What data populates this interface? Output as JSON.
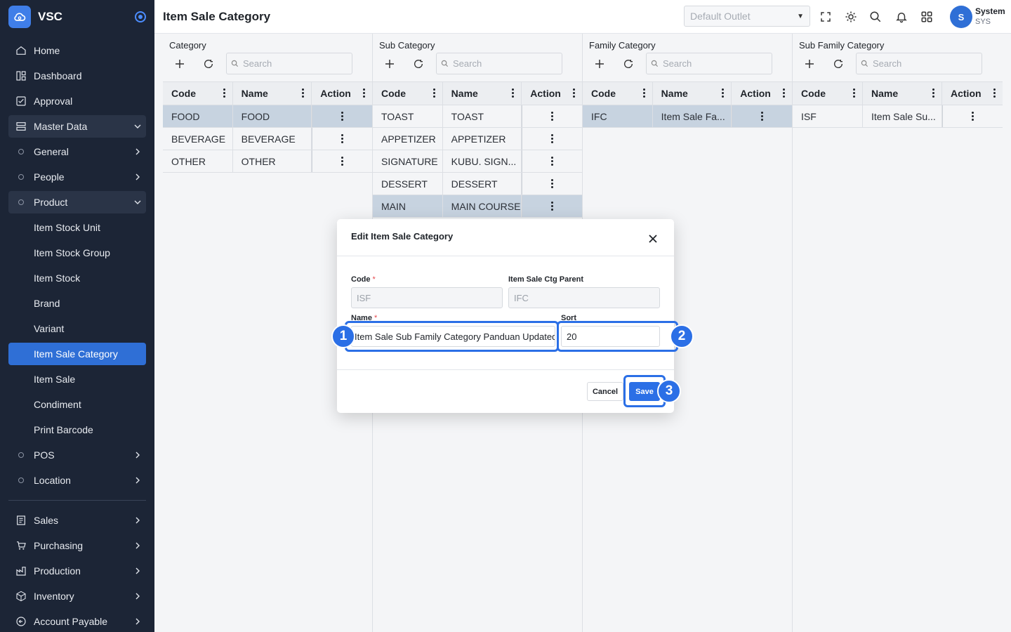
{
  "app": {
    "name": "VSC"
  },
  "sidebar": {
    "items": [
      {
        "label": "Home",
        "icon": "home-icon"
      },
      {
        "label": "Dashboard",
        "icon": "dashboard-icon"
      },
      {
        "label": "Approval",
        "icon": "approval-icon"
      },
      {
        "label": "Master Data",
        "icon": "master-data-icon"
      },
      {
        "label": "General"
      },
      {
        "label": "People"
      },
      {
        "label": "Product"
      },
      {
        "label": "Item Stock Unit"
      },
      {
        "label": "Item Stock Group"
      },
      {
        "label": "Item Stock"
      },
      {
        "label": "Brand"
      },
      {
        "label": "Variant"
      },
      {
        "label": "Item Sale Category"
      },
      {
        "label": "Item Sale"
      },
      {
        "label": "Condiment"
      },
      {
        "label": "Print Barcode"
      },
      {
        "label": "POS"
      },
      {
        "label": "Location"
      },
      {
        "label": "Sales",
        "icon": "sales-icon"
      },
      {
        "label": "Purchasing",
        "icon": "cart-icon"
      },
      {
        "label": "Production",
        "icon": "factory-icon"
      },
      {
        "label": "Inventory",
        "icon": "box-icon"
      },
      {
        "label": "Account Payable",
        "icon": "payable-icon"
      }
    ]
  },
  "header": {
    "title": "Item Sale Category",
    "outlet_placeholder": "Default Outlet",
    "user": {
      "initial": "S",
      "name": "System",
      "code": "SYS"
    }
  },
  "panels": [
    {
      "title": "Category",
      "search_placeholder": "Search",
      "columns": [
        "Code",
        "Name",
        "Action"
      ],
      "rows": [
        {
          "code": "FOOD",
          "name": "FOOD"
        },
        {
          "code": "BEVERAGE",
          "name": "BEVERAGE"
        },
        {
          "code": "OTHER",
          "name": "OTHER"
        }
      ]
    },
    {
      "title": "Sub Category",
      "search_placeholder": "Search",
      "columns": [
        "Code",
        "Name",
        "Action"
      ],
      "rows": [
        {
          "code": "TOAST",
          "name": "TOAST"
        },
        {
          "code": "APPETIZER",
          "name": "APPETIZER"
        },
        {
          "code": "SIGNATURE",
          "name": "KUBU. SIGN..."
        },
        {
          "code": "DESSERT",
          "name": "DESSERT"
        },
        {
          "code": "MAIN",
          "name": "MAIN COURSE"
        }
      ]
    },
    {
      "title": "Family Category",
      "search_placeholder": "Search",
      "columns": [
        "Code",
        "Name",
        "Action"
      ],
      "rows": [
        {
          "code": "IFC",
          "name": "Item Sale Fa..."
        }
      ]
    },
    {
      "title": "Sub Family Category",
      "search_placeholder": "Search",
      "columns": [
        "Code",
        "Name",
        "Action"
      ],
      "rows": [
        {
          "code": "ISF",
          "name": "Item Sale Su..."
        }
      ]
    }
  ],
  "modal": {
    "title": "Edit Item Sale Category",
    "code_label": "Code",
    "code_value": "ISF",
    "parent_label": "Item Sale Ctg Parent",
    "parent_value": "IFC",
    "name_label": "Name",
    "name_value": "Item Sale Sub Family Category Panduan Updated",
    "sort_label": "Sort",
    "sort_value": "20",
    "required_mark": "*",
    "cancel_label": "Cancel",
    "save_label": "Save"
  },
  "annotations": [
    "1",
    "2",
    "3"
  ],
  "colors": {
    "accent": "#2b6fe6",
    "sidebar_bg": "#1c2536",
    "selected_row": "#c7d3e0"
  }
}
